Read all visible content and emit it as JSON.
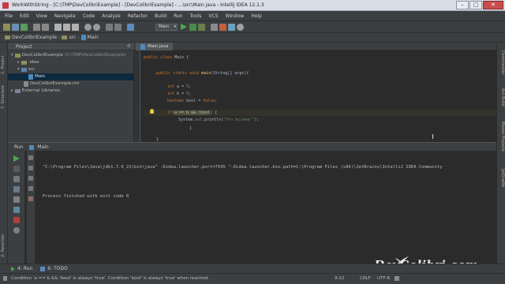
{
  "window": {
    "title": "WorkWithString - [C:\\TMP\\DevColibriExample] - [DevColibriExample] - ...\\src\\Main.java - IntelliJ IDEA 12.1.3",
    "controls": [
      "–",
      "□",
      "✕"
    ]
  },
  "menu": [
    "File",
    "Edit",
    "View",
    "Navigate",
    "Code",
    "Analyze",
    "Refactor",
    "Build",
    "Run",
    "Tools",
    "VCS",
    "Window",
    "Help"
  ],
  "toolbar": {
    "run_config": "Main"
  },
  "breadcrumb": [
    "DevColibriExample",
    "src",
    "Main"
  ],
  "left_strip": [
    "1: Project",
    "7: Structure",
    "2: Favorites"
  ],
  "right_strip": [
    "Commander",
    "Ant Build",
    "Maven Projects",
    "JetGradle"
  ],
  "project": {
    "header": "Project",
    "tree": [
      {
        "label": "DevColibriExample",
        "hint": "(C:\\TMP\\DevColibriExample)",
        "kind": "module"
      },
      {
        "label": ".idea",
        "hint": "",
        "kind": "folder"
      },
      {
        "label": "src",
        "hint": "",
        "kind": "folder"
      },
      {
        "label": "Main",
        "hint": "",
        "kind": "class"
      },
      {
        "label": "DevColibriExample.iml",
        "hint": "",
        "kind": "file"
      },
      {
        "label": "External Libraries",
        "hint": "",
        "kind": "lib"
      }
    ]
  },
  "editor": {
    "tab": "Main.java",
    "code": {
      "l1": {
        "kw": "public class ",
        "rest": "Main {"
      },
      "l2": {
        "kw": "public static void ",
        "fn": "main",
        "rest": "(String[] args){"
      },
      "l3": {
        "kw": "int ",
        "a": "a = ",
        "num": "5",
        "end": ";"
      },
      "l4": {
        "kw": "int ",
        "a": "b = ",
        "num": "5",
        "end": ";"
      },
      "l5": {
        "kw": "boolean ",
        "a": "bool = ",
        "kw2": "false",
        "end": ";"
      },
      "l6": {
        "kw": "if",
        "open": "(",
        "hl": "a == b && !bool",
        "close": ") {"
      },
      "l7": {
        "pre": "System.",
        "fld": "out",
        "mid": ".println(",
        "str": "\"Это истина!\"",
        "end": ");"
      },
      "l8": "}",
      "l9": "}"
    }
  },
  "run": {
    "tab_label": "Run",
    "config": "Main",
    "output": [
      "\"C:\\Program Files\\Java\\jdk1.7.0_21\\bin\\java\" -Didea.launcher.port=7545 \"-Didea.launcher.bin.path=C:\\Program Files (x86)\\JetBrains\\IntelliJ IDEA Community",
      "",
      "Process finished with exit code 0"
    ]
  },
  "bottom_tabs": [
    "4: Run",
    "6: TODO"
  ],
  "status": {
    "message": "Condition 'a == b && !bool' is always 'true'. Condition 'bool' is always 'true' when reached.",
    "position": "9:22",
    "line_sep": "CRLF",
    "encoding": "UTF-8"
  },
  "watermark": "DevColibri.com",
  "colors": {
    "accent_run": "#4da74d",
    "selection": "#0d293e",
    "keyword": "#cc7832",
    "number": "#6897bb",
    "string": "#6a8759"
  }
}
